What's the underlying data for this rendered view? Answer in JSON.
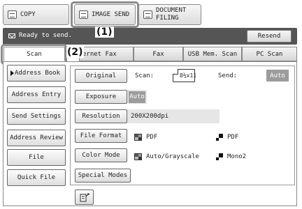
{
  "mode_tabs": {
    "copy": "COPY",
    "image_send": "IMAGE SEND",
    "document_filing_line1": "DOCUMENT",
    "document_filing_line2": "FILING"
  },
  "callouts": {
    "one": "(1)",
    "two": "(2)"
  },
  "status": {
    "text": "Ready to send.",
    "resend": "Resend"
  },
  "sub_tabs": [
    "Scan",
    "ernet Fax",
    "Fax",
    "USB Mem. Scan",
    "PC Scan"
  ],
  "side_buttons": [
    "Address Book",
    "Address Entry",
    "Send Settings",
    "Address Review",
    "File",
    "Quick File"
  ],
  "settings": {
    "original": {
      "label": "Original",
      "scan_label": "Scan:",
      "scan_size": "8½x11",
      "send_label": "Send:",
      "send_value": "Auto"
    },
    "exposure": {
      "label": "Exposure",
      "value": "Auto"
    },
    "resolution": {
      "label": "Resolution",
      "value": "200X200dpi"
    },
    "file_format": {
      "label": "File Format",
      "color_value": "PDF",
      "mono_value": "PDF"
    },
    "color_mode": {
      "label": "Color Mode",
      "color_value": "Auto/Grayscale",
      "mono_value": "Mono2"
    },
    "special_modes": {
      "label": "Special Modes"
    }
  },
  "icons": {
    "mode": "document-icon",
    "status": "envelope-icon",
    "color": "color-blocks-icon",
    "mono": "mono-blocks-icon",
    "nav": "document-edit-icon"
  },
  "colors": {
    "status_bar": "#555555",
    "auto_chip": "#9c9c9c",
    "highlight": "#8c8c8c"
  }
}
